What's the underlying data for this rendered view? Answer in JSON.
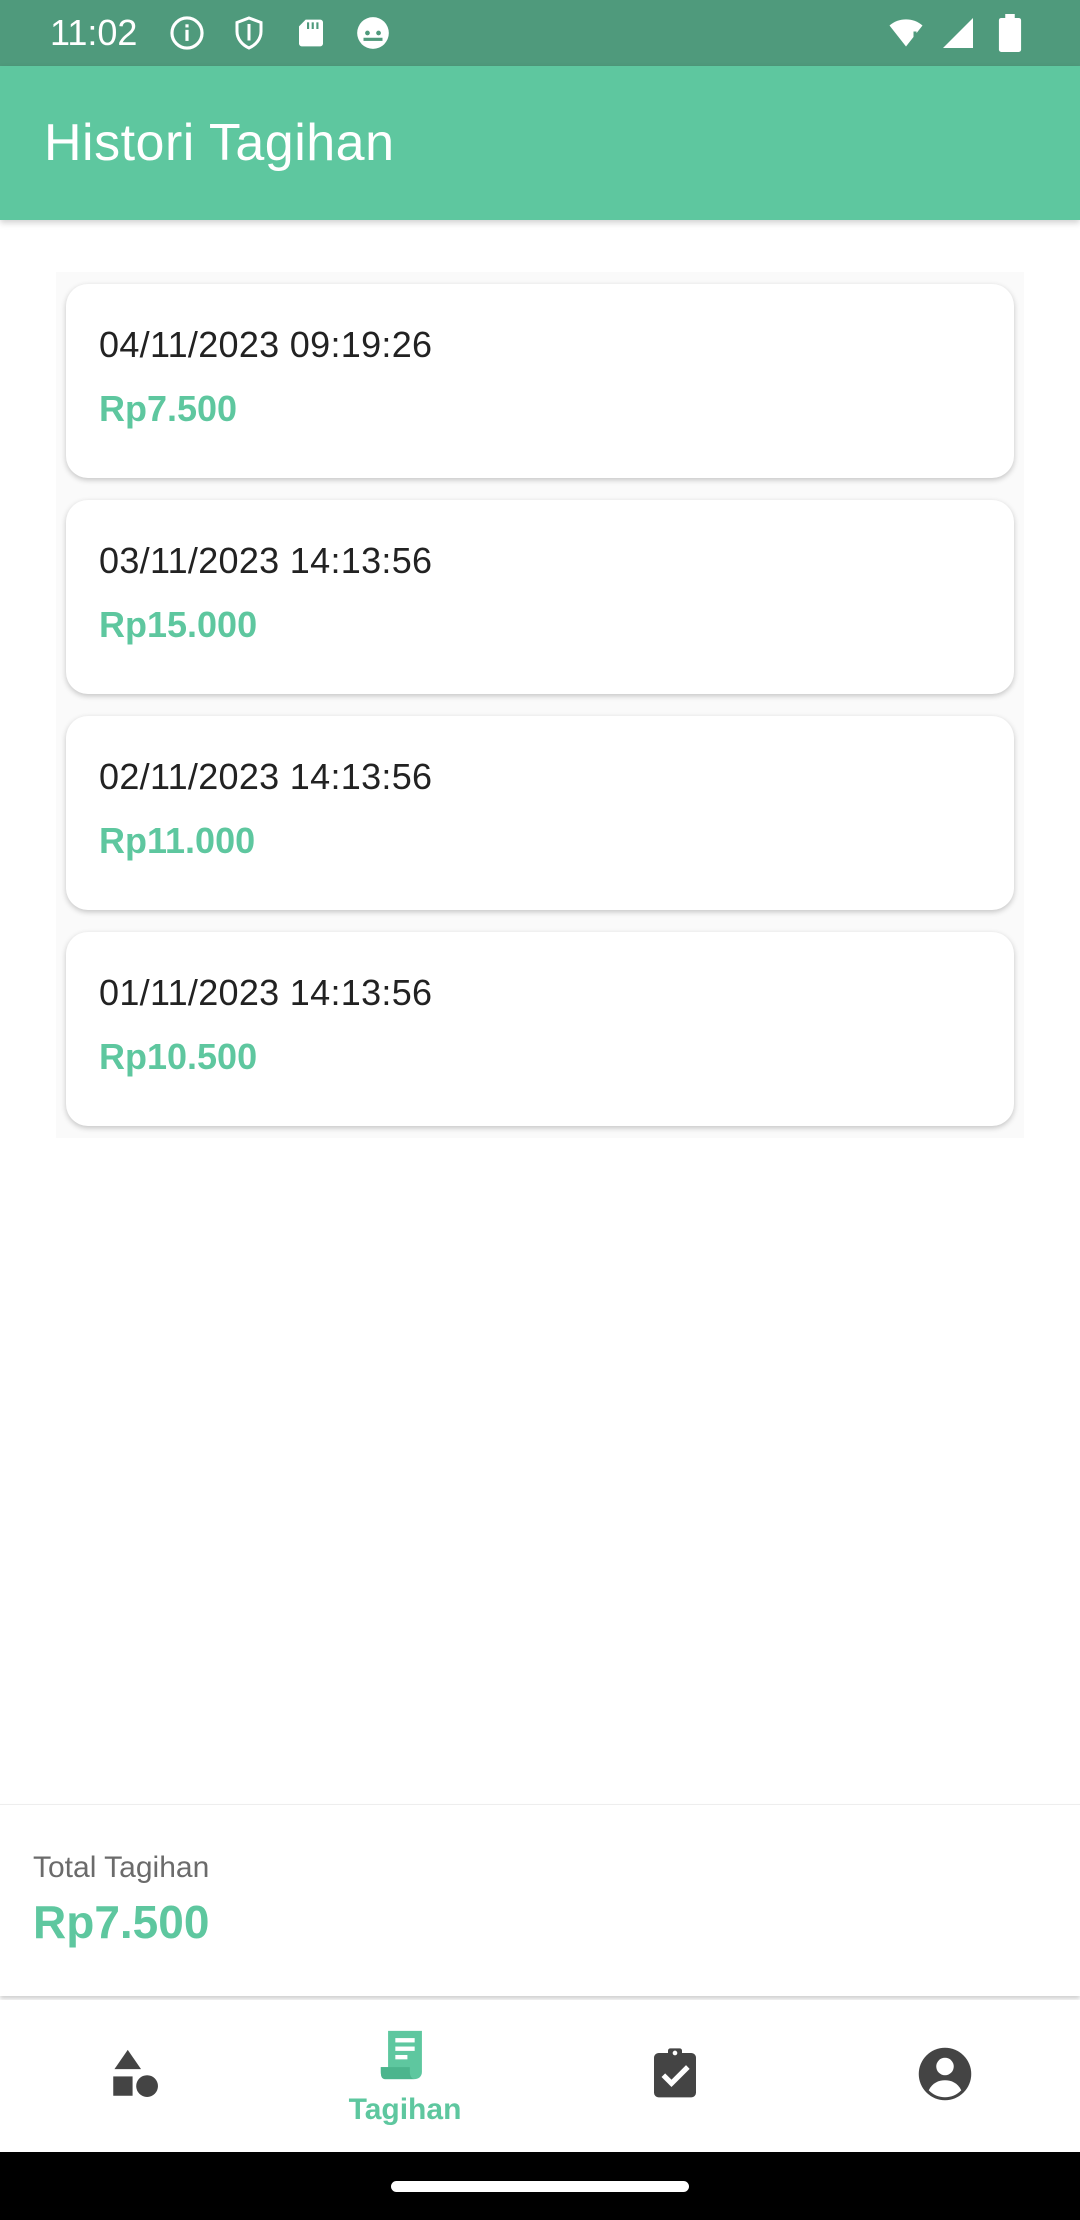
{
  "status_bar": {
    "time": "11:02",
    "left_icons": [
      "info-icon",
      "shield-icon",
      "sd-card-icon",
      "android-icon"
    ],
    "right_icons": [
      "wifi-icon",
      "signal-icon",
      "battery-icon"
    ]
  },
  "app_bar": {
    "title": "Histori Tagihan",
    "color": "#5ec79f"
  },
  "bills": [
    {
      "date": "04/11/2023 09:19:26",
      "amount": "Rp7.500"
    },
    {
      "date": "03/11/2023 14:13:56",
      "amount": "Rp15.000"
    },
    {
      "date": "02/11/2023 14:13:56",
      "amount": "Rp11.000"
    },
    {
      "date": "01/11/2023 14:13:56",
      "amount": "Rp10.500"
    }
  ],
  "total": {
    "label": "Total Tagihan",
    "value": "Rp7.500"
  },
  "bottom_nav": {
    "items": [
      {
        "icon": "category-icon",
        "label": "",
        "active": false
      },
      {
        "icon": "receipt-icon",
        "label": "Tagihan",
        "active": true
      },
      {
        "icon": "assignment-check-icon",
        "label": "",
        "active": false
      },
      {
        "icon": "account-circle-icon",
        "label": "",
        "active": false
      }
    ],
    "active_color": "#5ec79f",
    "inactive_color": "#444444"
  }
}
